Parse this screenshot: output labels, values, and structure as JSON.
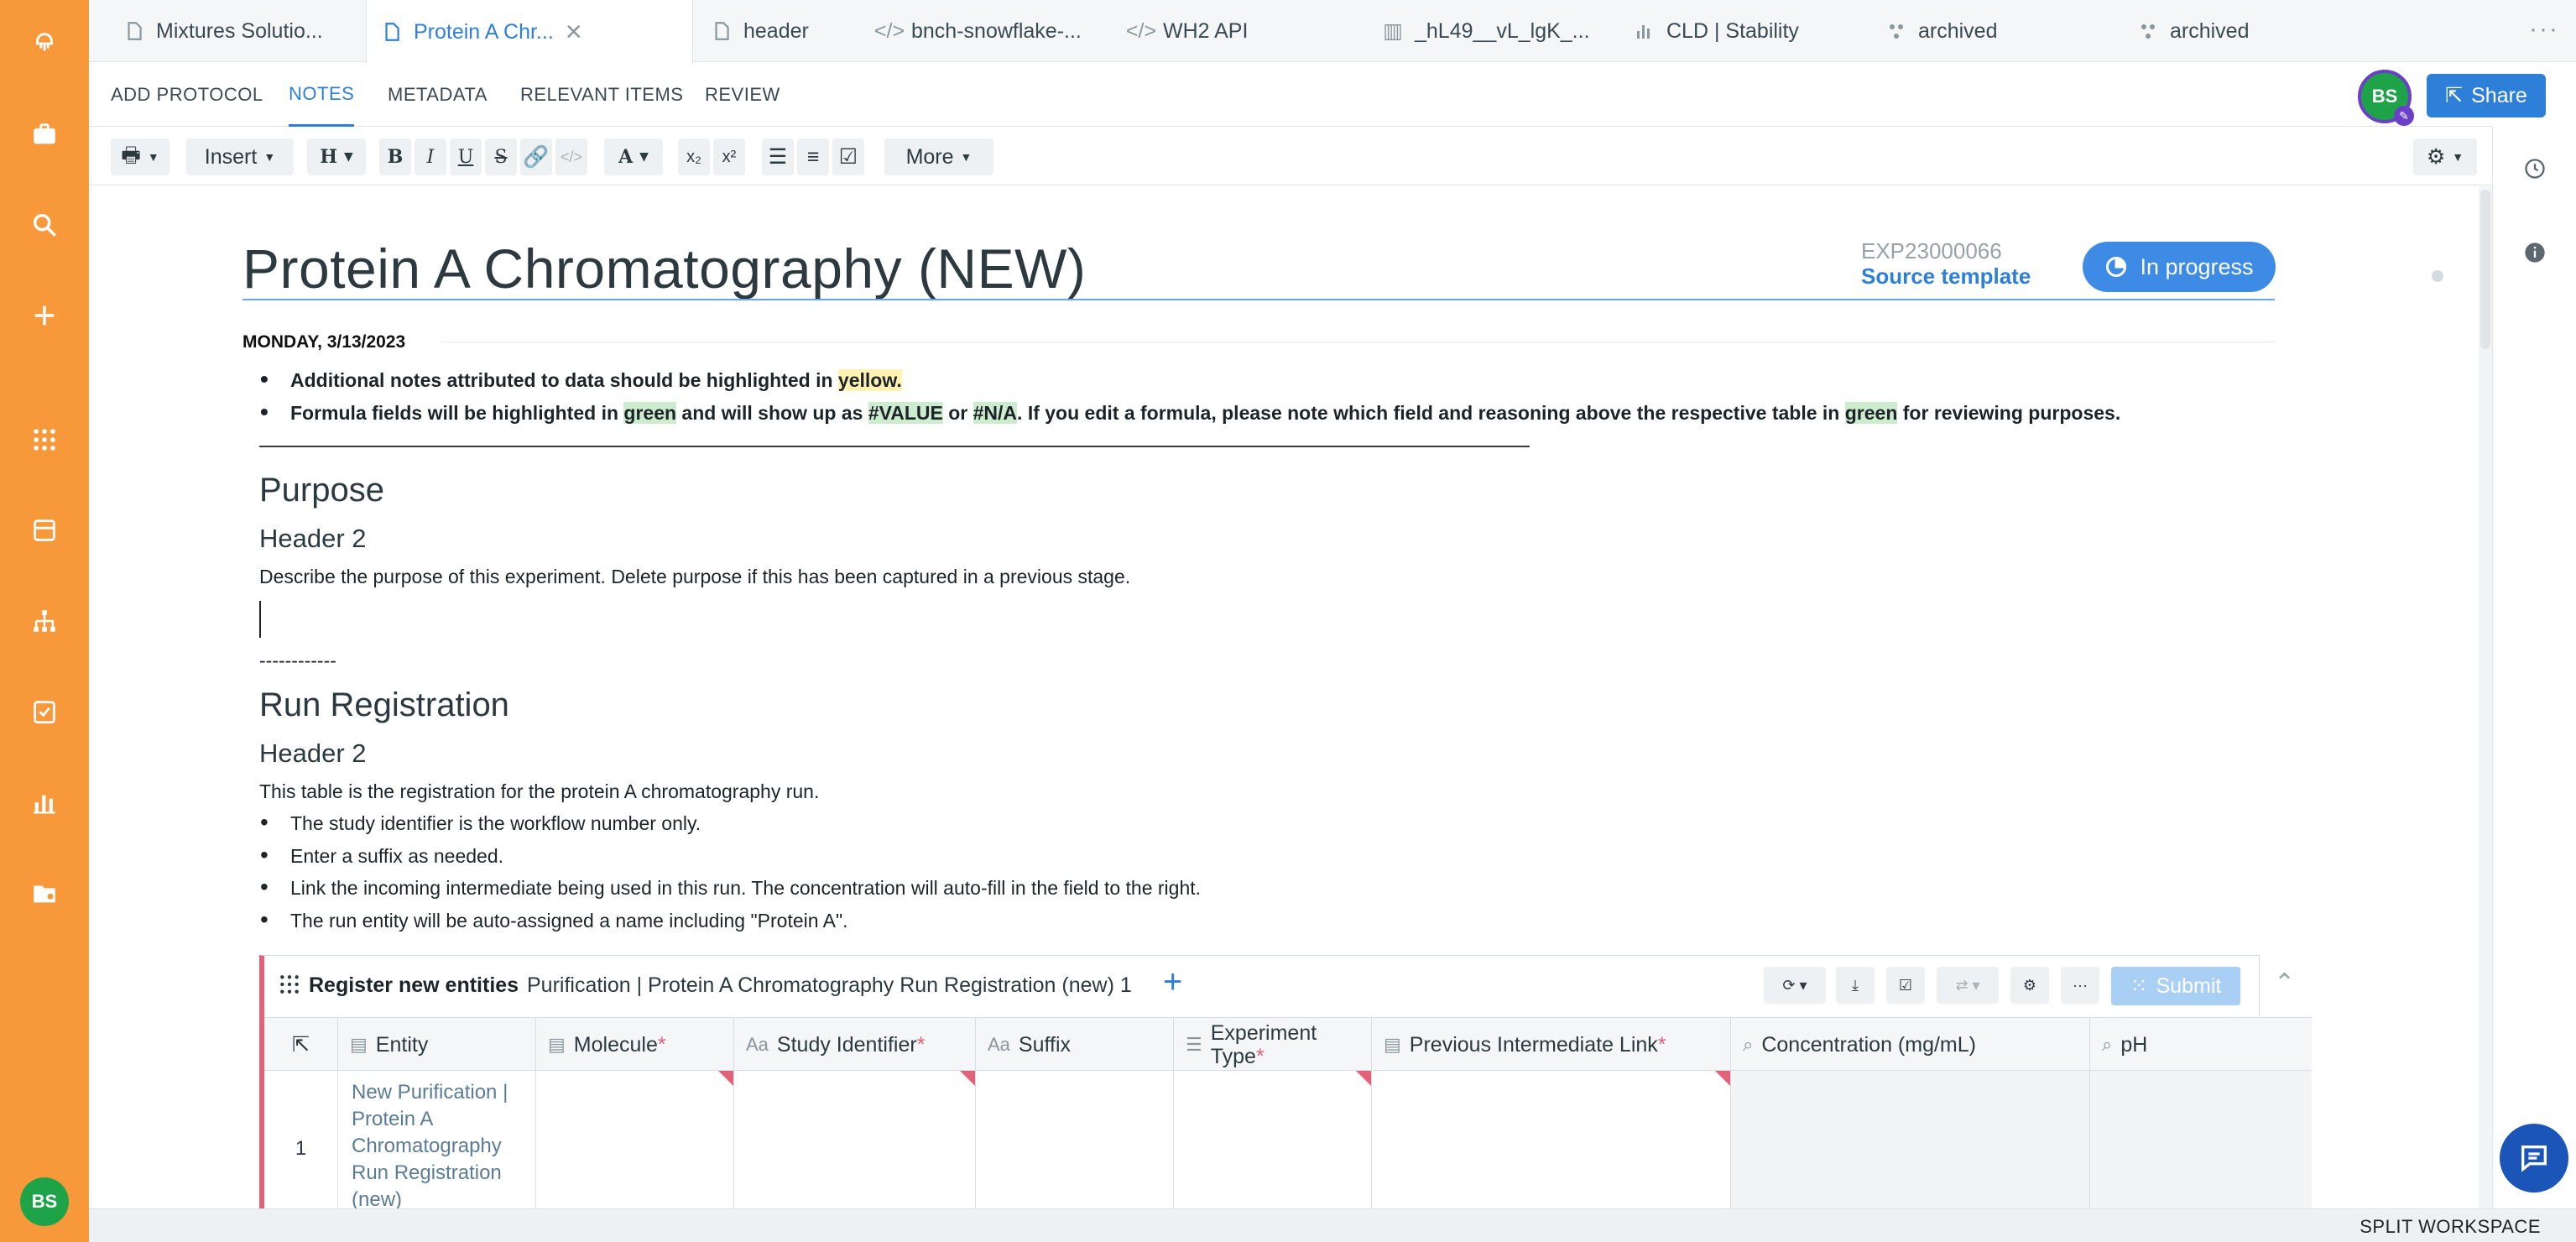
{
  "tabs": [
    {
      "label": "Mixtures Solutio...",
      "icon": "document-icon"
    },
    {
      "label": "Protein A Chr...",
      "icon": "document-icon",
      "active": true
    },
    {
      "label": "header",
      "icon": "document-icon"
    },
    {
      "label": "bnch-snowflake-...",
      "icon": "code-icon"
    },
    {
      "label": "WH2 API",
      "icon": "code-icon"
    },
    {
      "label": "_hL49__vL_lgK_...",
      "icon": "ruler-icon"
    },
    {
      "label": "CLD | Stability",
      "icon": "chart-icon"
    },
    {
      "label": "archived",
      "icon": "workflow-icon"
    },
    {
      "label": "archived",
      "icon": "workflow-icon"
    }
  ],
  "subnav": [
    {
      "label": "ADD PROTOCOL"
    },
    {
      "label": "NOTES",
      "active": true
    },
    {
      "label": "METADATA"
    },
    {
      "label": "RELEVANT ITEMS"
    },
    {
      "label": "REVIEW"
    }
  ],
  "user": {
    "initials": "BS"
  },
  "share_label": "Share",
  "toolbar": {
    "insert_label": "Insert",
    "heading_label": "H",
    "bold": "B",
    "italic": "I",
    "underline": "U",
    "strike": "S",
    "font_color": "A",
    "subscript": "x₂",
    "superscript": "x²",
    "more_label": "More"
  },
  "document": {
    "title": "Protein A Chromatography (NEW)",
    "exp_id": "EXP23000066",
    "source_template": "Source template",
    "status": "In progress",
    "date": "MONDAY, 3/13/2023",
    "notes": {
      "line1_pre": "Additional notes attributed to data should be highlighted in ",
      "line1_hl": "yellow.",
      "line2_a": "Formula fields will be highlighted in ",
      "line2_green": "green",
      "line2_b": " and will show up as ",
      "line2_value": "#VALUE",
      "line2_or": " or ",
      "line2_na": "#N/A",
      "line2_c": ". If you edit a formula, please note which field and reasoning above the respective table in ",
      "line2_green2": "green",
      "line2_d": " for reviewing purposes."
    },
    "purpose_heading": "Purpose",
    "purpose_h2": "Header 2",
    "purpose_text": "Describe the purpose of this experiment. Delete purpose if this has been captured in a previous stage.",
    "divider_text": "------------",
    "run_heading": "Run Registration",
    "run_h2": "Header 2",
    "run_text": "This table is the registration for the protein A chromatography run.",
    "run_bullets": [
      "The study identifier is the workflow number only.",
      "Enter a suffix as needed.",
      "Link the incoming intermediate being used in this run. The concentration will auto-fill in the field to the right.",
      "The run entity will be auto-assigned a name including \"Protein A\"."
    ]
  },
  "registration": {
    "label": "Register new entities",
    "schema": "Purification | Protein A Chromatography Run Registration (new) 1",
    "submit_label": "Submit",
    "columns": [
      {
        "label": "Entity",
        "icon": "table-icon",
        "required": false
      },
      {
        "label": "Molecule",
        "icon": "table-icon",
        "required": true
      },
      {
        "label": "Study Identifier",
        "icon": "text-icon",
        "required": true
      },
      {
        "label": "Suffix",
        "icon": "text-icon",
        "required": false
      },
      {
        "label": "Experiment",
        "label2": "Type",
        "icon": "list-icon",
        "required": true
      },
      {
        "label": "Previous Intermediate Link",
        "icon": "table-icon",
        "required": true
      },
      {
        "label": "Concentration (mg/mL)",
        "icon": "lookup-icon",
        "required": false
      },
      {
        "label": "pH",
        "icon": "lookup-icon",
        "required": false
      }
    ],
    "rows": [
      {
        "num": "1",
        "entity": "New Purification | Protein A Chromatography Run Registration (new)"
      }
    ],
    "req_mark": "*"
  },
  "footer": {
    "split_workspace": "SPLIT WORKSPACE"
  },
  "colors": {
    "sidebar": "#f7993a",
    "accent": "#2e7fd8",
    "status": "#3e8be5",
    "required": "#e2627a"
  }
}
